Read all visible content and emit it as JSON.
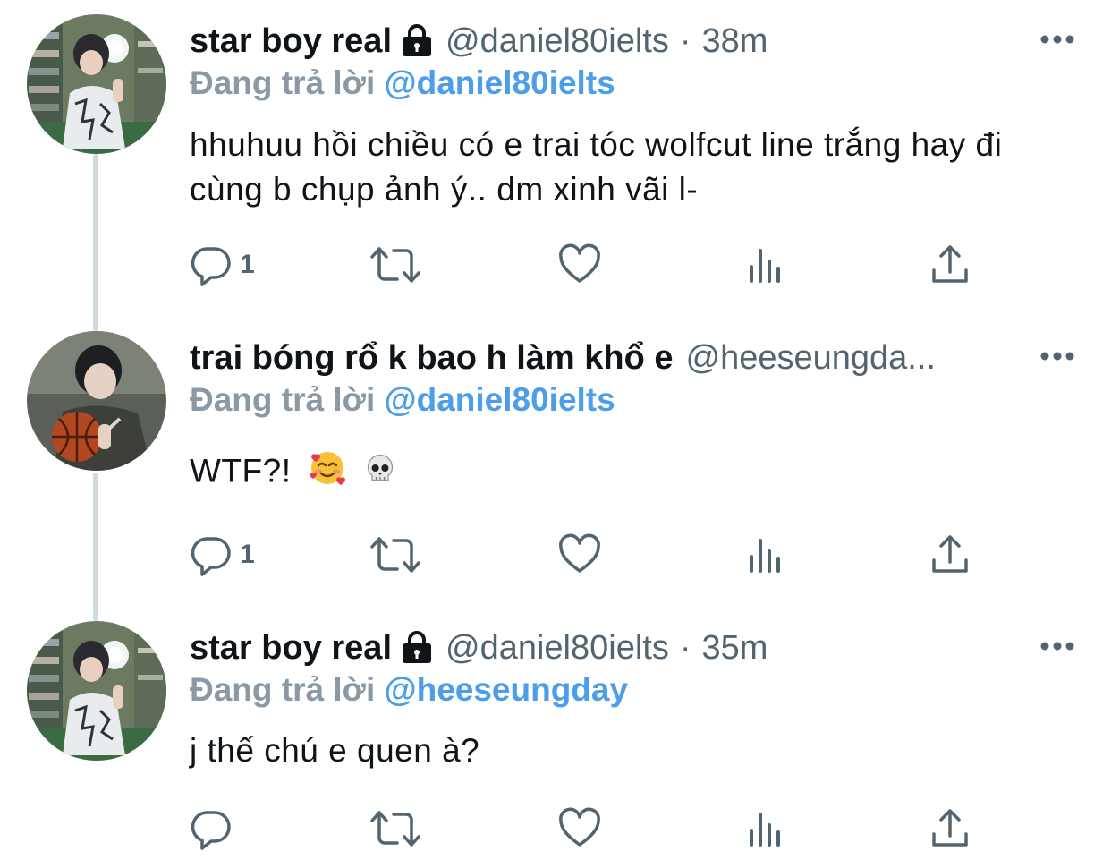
{
  "tweets": [
    {
      "display_name": "star boy real",
      "locked": true,
      "handle": "@daniel80ielts",
      "separator": "·",
      "time": "38m",
      "reply_label": "Đang trả lời",
      "reply_to": "@daniel80ielts",
      "text": "hhuhuu hồi chiều có e trai tóc wolfcut line trắng hay đi cùng b chụp ảnh ý..  dm xinh vãi l-",
      "reply_count": "1",
      "avatar": "mirror-selfie-avatar"
    },
    {
      "display_name": "trai bóng rổ k bao h làm khổ e",
      "locked": false,
      "handle": "@heeseungda...",
      "separator": "",
      "time": "",
      "reply_label": "Đang trả lời",
      "reply_to": "@daniel80ielts",
      "text": "WTF?!",
      "emojis": [
        "smiling-face-with-hearts",
        "skull"
      ],
      "reply_count": "1",
      "avatar": "basketball-avatar"
    },
    {
      "display_name": "star boy real",
      "locked": true,
      "handle": "@daniel80ielts",
      "separator": "·",
      "time": "35m",
      "reply_label": "Đang trả lời",
      "reply_to": "@heeseungday",
      "text": "j thế chú e quen à?",
      "reply_count": "",
      "avatar": "mirror-selfie-avatar"
    }
  ],
  "colors": {
    "text": "#0f1419",
    "secondary": "#536471",
    "reply_label": "#8b98a5",
    "link": "#4d9ee8",
    "thread_line": "#cfd9de"
  }
}
